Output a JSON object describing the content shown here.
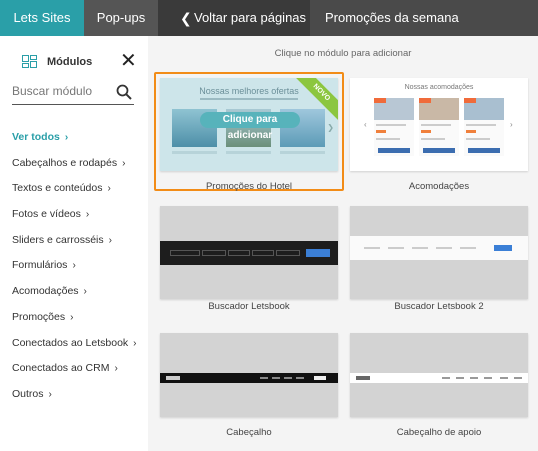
{
  "topbar": {
    "tabs": [
      "Lets Sites",
      "Pop-ups"
    ],
    "back_label": "Voltar para páginas",
    "page_title": "Promoções da semana"
  },
  "sidebar": {
    "title": "Módulos",
    "search_placeholder": "Buscar módulo",
    "items": [
      {
        "label": "Ver todos",
        "active": true
      },
      {
        "label": "Cabeçalhos e rodapés"
      },
      {
        "label": "Textos e conteúdos"
      },
      {
        "label": "Fotos e vídeos"
      },
      {
        "label": "Sliders e carrosséis"
      },
      {
        "label": "Formulários"
      },
      {
        "label": "Acomodações"
      },
      {
        "label": "Promoções"
      },
      {
        "label": "Conectados ao Letsbook"
      },
      {
        "label": "Conectados ao CRM"
      },
      {
        "label": "Outros"
      }
    ]
  },
  "main": {
    "hint": "Clique no módulo para adicionar",
    "modules": [
      {
        "label": "Promoções do Hotel",
        "selected": true,
        "preview_title": "Nossas melhores ofertas",
        "preview_button": "Clique para adicionar",
        "badge": "NOVO"
      },
      {
        "label": "Acomodações",
        "preview_title": "Nossas acomodações"
      },
      {
        "label": "Buscador Letsbook"
      },
      {
        "label": "Buscador Letsbook 2"
      },
      {
        "label": "Cabeçalho"
      },
      {
        "label": "Cabeçalho de apoio"
      }
    ]
  },
  "colors": {
    "accent": "#2a9fa8",
    "selected_border": "#f28c17",
    "badge": "#8cc63f",
    "topbar": "#4a4a4a"
  },
  "icons": [
    "modules-grid-icon",
    "close-icon",
    "search-icon",
    "chevron-left-icon",
    "chevron-right-icon"
  ]
}
